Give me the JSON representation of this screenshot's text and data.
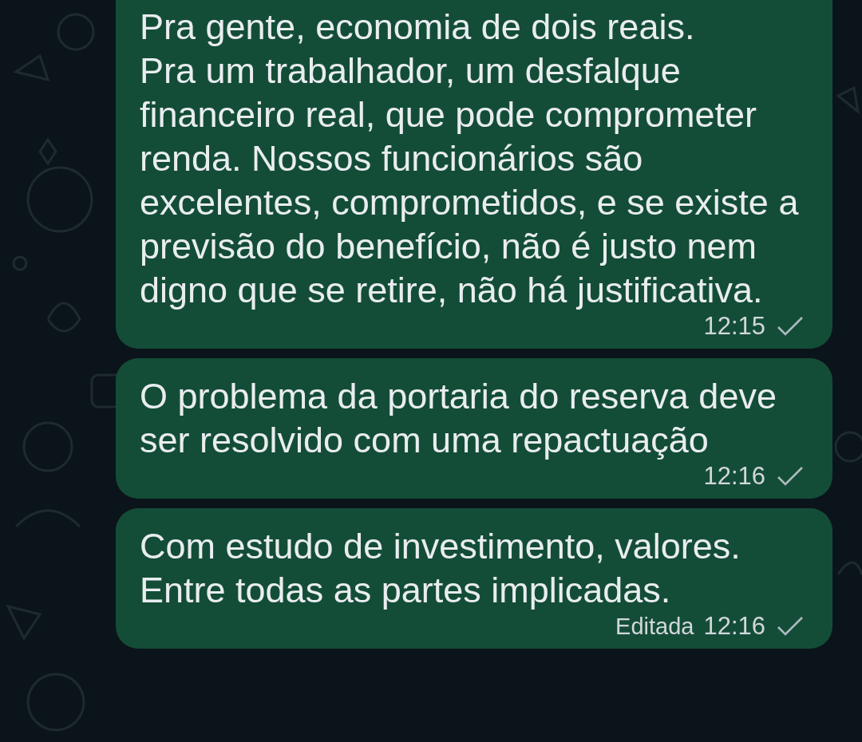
{
  "messages": [
    {
      "text": "Pra gente, economia de dois reais.\nPra um trabalhador, um desfalque financeiro real, que pode comprometer renda. Nossos funcionários são excelentes, comprometidos, e se existe a previsão do benefício, não é justo nem digno que se retire, não há justificativa.",
      "time": "12:15",
      "delivered": false,
      "cut_top": true
    },
    {
      "text": "O problema da portaria do reserva deve ser resolvido com uma repactuação",
      "time": "12:16",
      "delivered": false,
      "cut_top": false
    },
    {
      "text": "Com estudo de investimento, valores.\nEntre todas as partes implicadas.",
      "time": "12:16",
      "edited_label": "Editada",
      "delivered": false,
      "cut_top": false
    }
  ]
}
